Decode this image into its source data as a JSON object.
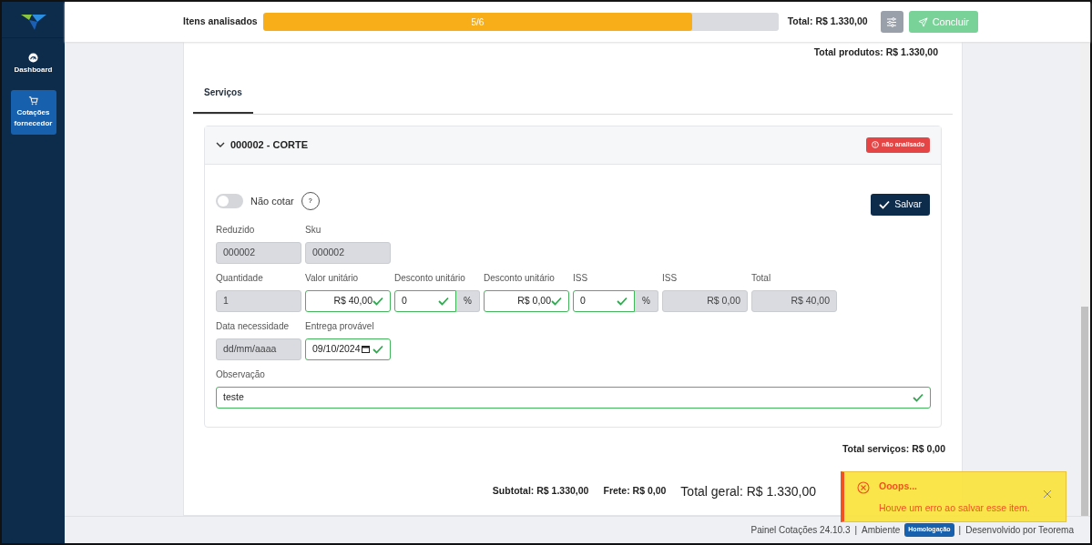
{
  "sidebar": {
    "items": [
      {
        "label": "Dashboard",
        "selected": false
      },
      {
        "label": "Cotações fornecedor",
        "selected": true
      }
    ]
  },
  "header": {
    "progress_label": "Itens analisados",
    "progress": {
      "level": 0.833,
      "text": "5/6"
    },
    "total": "Total: R$  1.330,00",
    "submit_button": {
      "label": "Concluir",
      "disabled": true
    }
  },
  "products_total": "Total produtos: R$  1.330,00",
  "tabs": [
    {
      "label": "Serviços",
      "selected": true
    }
  ],
  "item": {
    "title": "000002 - CORTE",
    "expanded": true,
    "status": "não analisado",
    "no_quote": {
      "label": "Não cotar",
      "on": false,
      "help": "?"
    },
    "save_button": "Salvar",
    "rows": [
      [
        {
          "label": "Reduzido",
          "value": "000002",
          "kind": "text",
          "readonly": true
        },
        {
          "label": "Sku",
          "value": "000002",
          "kind": "text",
          "readonly": true
        }
      ],
      [
        {
          "label": "Quantidade",
          "value": "1",
          "kind": "text",
          "readonly": true
        },
        {
          "label": "Valor unitário",
          "value": "R$ 40,00",
          "kind": "money",
          "readonly": false,
          "valid": true
        },
        {
          "label": "Desconto unitário",
          "value": "0",
          "kind": "percent",
          "addon": "%",
          "readonly": false,
          "valid": true
        },
        {
          "label": "Desconto unitário",
          "value": "R$ 0,00",
          "kind": "money",
          "readonly": false,
          "valid": true
        },
        {
          "label": "ISS",
          "value": "0",
          "kind": "percent",
          "addon": "%",
          "readonly": false,
          "valid": true
        },
        {
          "label": "ISS",
          "value": "R$ 0,00",
          "kind": "money",
          "readonly": true
        },
        {
          "label": "Total",
          "value": "R$  40,00",
          "kind": "money",
          "readonly": true
        }
      ],
      [
        {
          "label": "Data necessidade",
          "value": "dd/mm/aaaa",
          "kind": "text",
          "readonly": true
        },
        {
          "label": "Entrega provável",
          "value": "09/10/2024",
          "kind": "date",
          "readonly": false,
          "valid": true
        }
      ]
    ],
    "note": {
      "label": "Observação",
      "value": "teste",
      "valid": true
    }
  },
  "services_total": "Total serviços: R$  0,00",
  "summary": {
    "subtotal": "Subtotal: R$  1.330,00",
    "freight": "Frete: R$  0,00",
    "grand_total": "Total geral: R$  1.330,00"
  },
  "footer": {
    "app": "Painel Cotações  24.10.3",
    "separators": [
      "|",
      "|"
    ],
    "environment_label": "Ambiente",
    "environment": "Homologação",
    "developer": "Desenvolvido por Teorema"
  },
  "toast": {
    "title": "Ooops...",
    "message": "Houve um erro ao salvar esse item."
  }
}
